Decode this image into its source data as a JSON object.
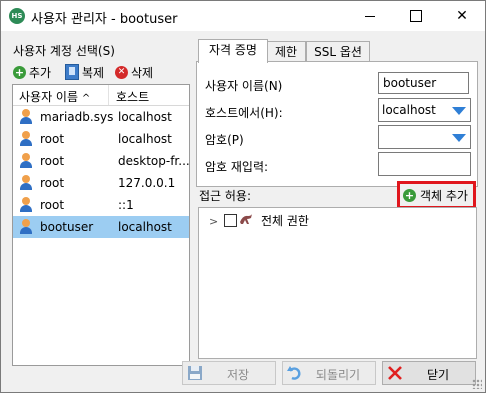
{
  "window": {
    "title": "사용자 관리자 - bootuser",
    "icon_text": "HS"
  },
  "left": {
    "select_label": "사용자 계정 선택(S)",
    "toolbar": {
      "add_label": "추가",
      "copy_label": "복제",
      "delete_label": "삭제"
    },
    "columns": [
      "사용자 이름",
      "호스트"
    ],
    "sort_indicator": "^",
    "users": [
      {
        "name": "mariadb.sys",
        "host": "localhost",
        "selected": false
      },
      {
        "name": "root",
        "host": "localhost",
        "selected": false
      },
      {
        "name": "root",
        "host": "desktop-fr...",
        "selected": false
      },
      {
        "name": "root",
        "host": "127.0.0.1",
        "selected": false
      },
      {
        "name": "root",
        "host": "::1",
        "selected": false
      },
      {
        "name": "bootuser",
        "host": "localhost",
        "selected": true
      }
    ]
  },
  "tabs": [
    {
      "label": "자격 증명",
      "active": true
    },
    {
      "label": "제한",
      "active": false
    },
    {
      "label": "SSL 옵션",
      "active": false
    }
  ],
  "form": {
    "username_label": "사용자 이름(N)",
    "username_value": "bootuser",
    "host_label": "호스트에서(H):",
    "host_value": "localhost",
    "password_label": "암호(P)",
    "password_value": "",
    "reenter_label": "암호 재입력:",
    "reenter_value": ""
  },
  "access": {
    "label": "접근 허용:",
    "add_object_label": "객체 추가",
    "tree_item_label": "전체 권한",
    "highlight_color": "#e0161d"
  },
  "buttons": {
    "save_label": "저장",
    "revert_label": "되돌리기",
    "close_label": "닫기"
  },
  "colors": {
    "selection": "#9ccdf2",
    "accent": "#2f7fd6"
  }
}
